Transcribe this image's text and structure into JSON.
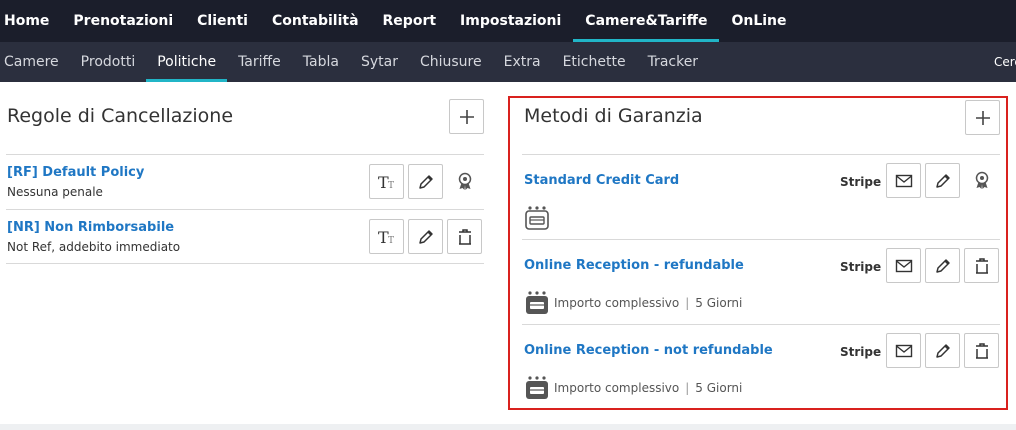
{
  "topnav": [
    "Home",
    "Prenotazioni",
    "Clienti",
    "Contabilità",
    "Report",
    "Impostazioni",
    "Camere&Tariffe",
    "OnLine"
  ],
  "topnav_active": "Camere&Tariffe",
  "subnav": [
    "Camere",
    "Prodotti",
    "Politiche",
    "Tariffe",
    "Tabla",
    "Sytar",
    "Chiusure",
    "Extra",
    "Etichette",
    "Tracker"
  ],
  "subnav_active": "Politiche",
  "subnav_search": "Cerc",
  "cancellation": {
    "title": "Regole di Cancellazione",
    "items": [
      {
        "name": "[RF] Default Policy",
        "description": "Nessuna penale"
      },
      {
        "name": "[NR] Non Rimborsabile",
        "description": "Not Ref, addebito immediato"
      }
    ]
  },
  "guarantee": {
    "title": "Metodi di Garanzia",
    "items": [
      {
        "name": "Standard Credit Card",
        "provider": "Stripe"
      },
      {
        "name": "Online Reception - refundable",
        "provider": "Stripe",
        "detail_amount": "Importo complessivo",
        "detail_days": "5 Giorni"
      },
      {
        "name": "Online Reception - not refundable",
        "provider": "Stripe",
        "detail_amount": "Importo complessivo",
        "detail_days": "5 Giorni"
      }
    ]
  },
  "colors": {
    "topbar": "#1b1e2b",
    "subbar": "#2b2f3e",
    "accent": "#21b5c7",
    "link": "#1f77c4",
    "highlight_border": "#d9211e"
  },
  "icons": {
    "add": "plus-icon",
    "text": "text-format-icon",
    "edit": "pencil-icon",
    "delete": "trash-icon",
    "default": "award-icon",
    "email": "envelope-icon",
    "payment": "payment-terminal-icon"
  }
}
